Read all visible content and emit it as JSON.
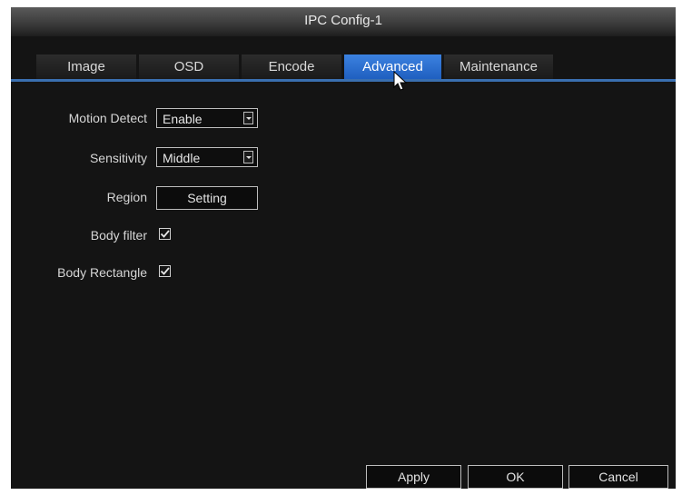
{
  "window": {
    "title": "IPC Config-1"
  },
  "tabs": [
    {
      "label": "Image",
      "active": false
    },
    {
      "label": "OSD",
      "active": false
    },
    {
      "label": "Encode",
      "active": false
    },
    {
      "label": "Advanced",
      "active": true
    },
    {
      "label": "Maintenance",
      "active": false
    }
  ],
  "form": {
    "motion_detect": {
      "label": "Motion Detect",
      "value": "Enable"
    },
    "sensitivity": {
      "label": "Sensitivity",
      "value": "Middle"
    },
    "region": {
      "label": "Region",
      "button_label": "Setting"
    },
    "body_filter": {
      "label": "Body filter",
      "checked": true
    },
    "body_rectangle": {
      "label": "Body Rectangle",
      "checked": true
    }
  },
  "buttons": {
    "apply": "Apply",
    "ok": "OK",
    "cancel": "Cancel"
  },
  "colors": {
    "accent": "#2f6fd0",
    "background": "#141414",
    "text": "#d6d6d6"
  },
  "icons": {
    "cursor": "mouse-pointer-icon",
    "dropdown": "chevron-down-icon",
    "check": "checkmark-icon"
  }
}
